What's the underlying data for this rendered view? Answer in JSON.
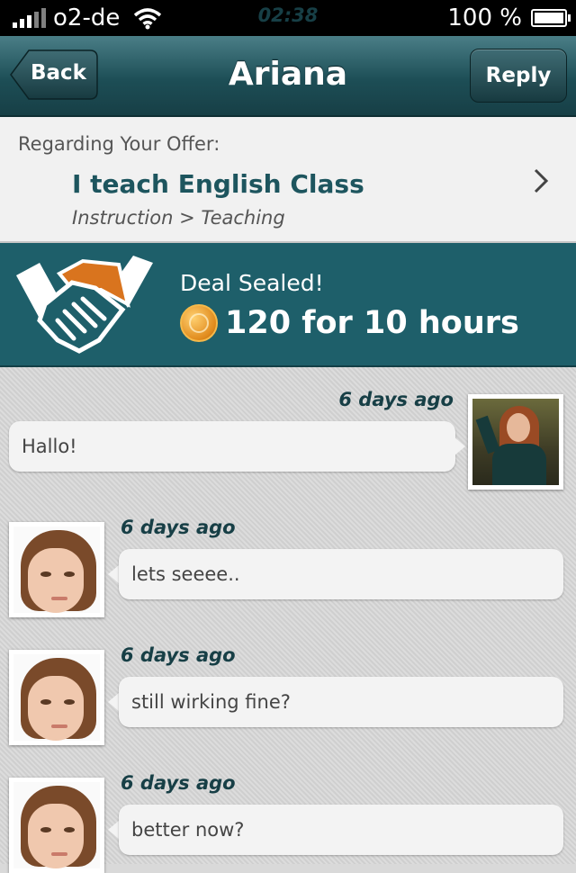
{
  "status_bar": {
    "carrier": "o2-de",
    "time": "02:38",
    "battery": "100 %"
  },
  "navbar": {
    "back_label": "Back",
    "title": "Ariana",
    "reply_label": "Reply"
  },
  "offer": {
    "regarding_label": "Regarding Your Offer:",
    "title": "I teach English Class",
    "category": "Instruction > Teaching"
  },
  "deal": {
    "label": "Deal Sealed!",
    "price": "120 for 10 hours"
  },
  "messages": [
    {
      "time": "6 days ago",
      "text": "Hallo!",
      "from": "other"
    },
    {
      "time": "6 days ago",
      "text": "lets seeee..",
      "from": "me"
    },
    {
      "time": "6 days ago",
      "text": "still wirking fine?",
      "from": "me"
    },
    {
      "time": "6 days ago",
      "text": "better now?",
      "from": "me"
    }
  ],
  "colors": {
    "navbar": "#1d4e56",
    "deal_banner": "#1e5f6a",
    "accent_text": "#1d555e",
    "handshake_orange": "#d9741e"
  }
}
